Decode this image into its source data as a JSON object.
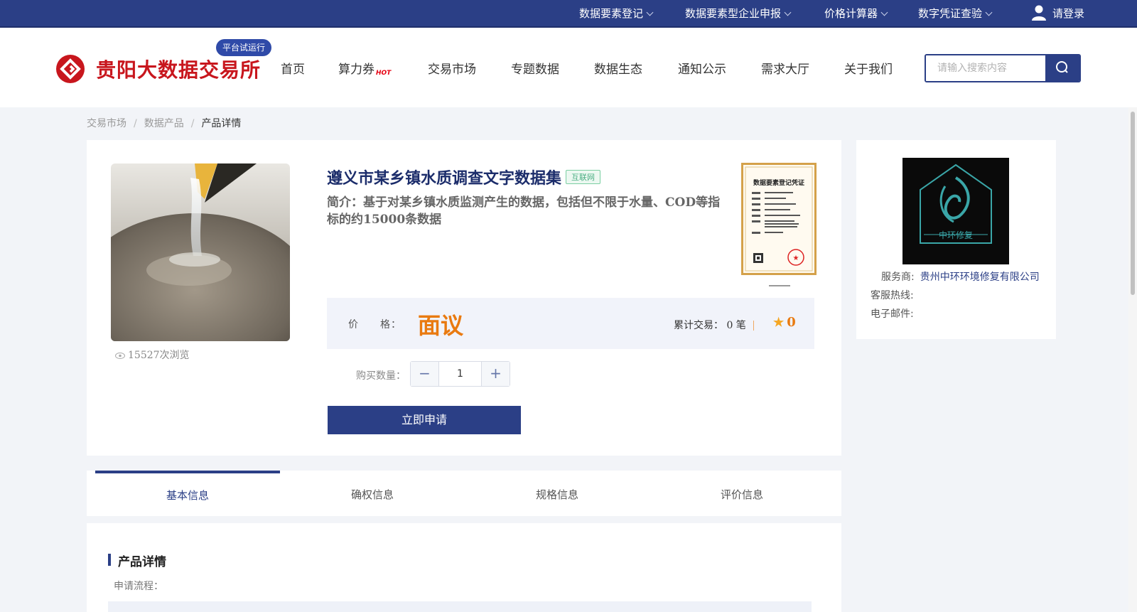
{
  "topbar": {
    "items": [
      {
        "label": "数据要素登记"
      },
      {
        "label": "数据要素型企业申报"
      },
      {
        "label": "价格计算器"
      },
      {
        "label": "数字凭证查验"
      }
    ],
    "login_label": "请登录"
  },
  "header": {
    "logo_text": "贵阳大数据交易所",
    "trial_badge": "平台试运行",
    "nav": [
      {
        "label": "首页"
      },
      {
        "label": "算力券",
        "hot": "HOT"
      },
      {
        "label": "交易市场"
      },
      {
        "label": "专题数据"
      },
      {
        "label": "数据生态"
      },
      {
        "label": "通知公示"
      },
      {
        "label": "需求大厅"
      },
      {
        "label": "关于我们"
      }
    ],
    "search": {
      "placeholder": "请输入搜索内容",
      "value": ""
    }
  },
  "breadcrumb": {
    "items": [
      "交易市场",
      "数据产品"
    ],
    "separator": "/",
    "current": "产品详情"
  },
  "product": {
    "views": "15527次浏览",
    "title": "遵义市某乡镇水质调查文字数据集",
    "tag": "互联网",
    "intro": "简介：基于对某乡镇水质监测产生的数据，包括但不限于水量、COD等指标的约15000条数据",
    "certificate_title": "数据要素登记凭证",
    "price_label": "价　　格：",
    "price_value": "面议",
    "trades_label": "累计交易：",
    "trades_value": "0 笔",
    "rating": "0",
    "quantity_label": "购买数量：",
    "quantity": "1",
    "apply_label": "立即申请"
  },
  "provider": {
    "logo_text": "中环修复",
    "service_label": "服务商:",
    "service_value": "贵州中环环境修复有限公司",
    "hotline_label": "客服热线:",
    "email_label": "电子邮件:"
  },
  "tabs": [
    {
      "label": "基本信息",
      "active": true
    },
    {
      "label": "确权信息"
    },
    {
      "label": "规格信息"
    },
    {
      "label": "评价信息"
    }
  ],
  "details": {
    "section_title": "产品详情",
    "flow_label": "申请流程："
  },
  "colors": {
    "brand_blue": "#2b3f86",
    "brand_red": "#c8161d",
    "price_orange": "#e97a10"
  }
}
